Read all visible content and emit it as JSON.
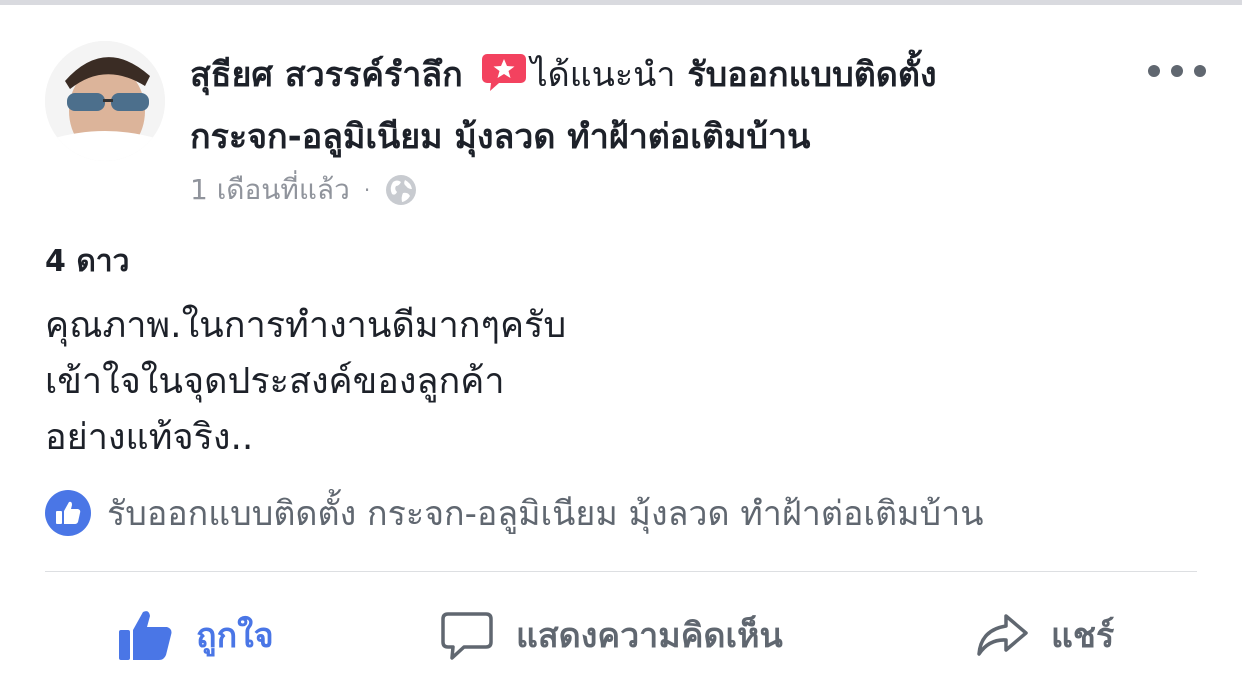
{
  "post": {
    "author_name": "สุธียศ สวรรค์รำลึก",
    "recommend_text": "ได้แนะนำ",
    "page_name_line1": "รับออกแบบติดตั้ง",
    "page_name_line2": "กระจก-อลูมิเนียม มุ้งลวด ทำฝ้าต่อเติมบ้าน",
    "timestamp": "1 เดือนที่แล้ว",
    "separator": "·",
    "privacy_icon": "globe-icon",
    "more_icon": "more-horizontal-icon"
  },
  "review": {
    "rating_label": "4 ดาว",
    "lines": [
      "คุณภาพ.ในการทำงานดีมากๆครับ",
      "เข้าใจในจุดประสงค์ของลูกค้า",
      "อย่างแท้จริง.."
    ]
  },
  "page_tag": {
    "icon": "like-badge-icon",
    "label": "รับออกแบบติดตั้ง กระจก-อลูมิเนียม มุ้งลวด ทำฝ้าต่อเติมบ้าน"
  },
  "actions": {
    "like_label": "ถูกใจ",
    "comment_label": "แสดงความคิดเห็น",
    "share_label": "แชร์"
  },
  "colors": {
    "like_blue": "#4a76e6",
    "recommend_red": "#f3425f",
    "secondary_text": "#90949c",
    "action_gray": "#606770"
  }
}
